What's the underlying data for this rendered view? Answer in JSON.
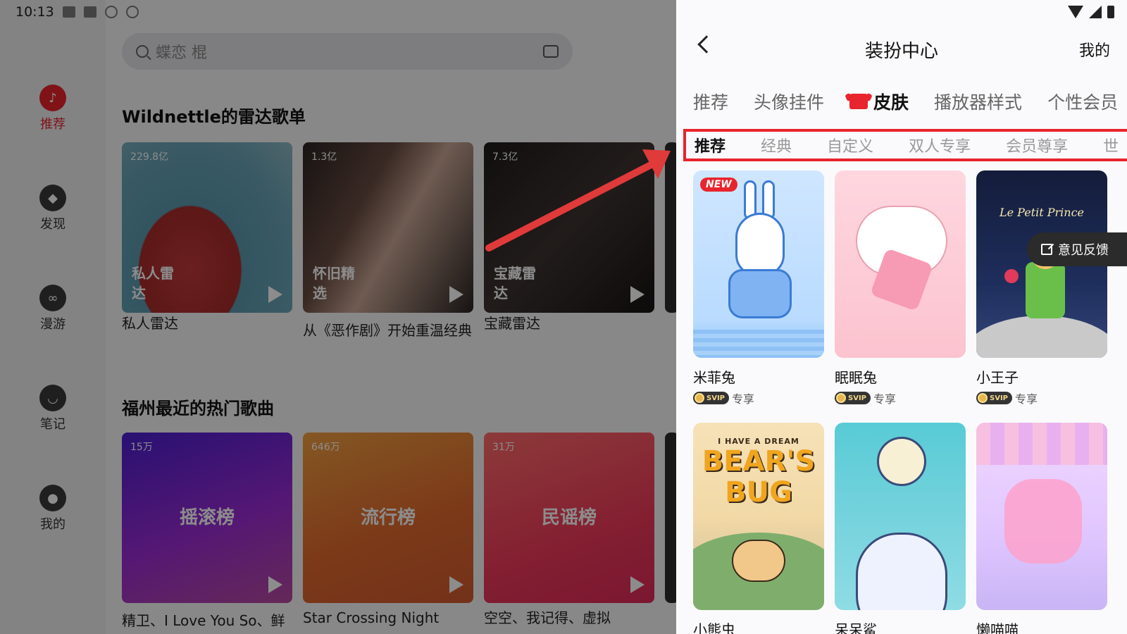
{
  "status_bar": {
    "time": "10:13"
  },
  "sidebar": {
    "items": [
      {
        "label": "推荐",
        "icon": "netease-logo-icon",
        "active": true
      },
      {
        "label": "发现",
        "icon": "compass-icon",
        "active": false
      },
      {
        "label": "漫游",
        "icon": "radio-icon",
        "active": false
      },
      {
        "label": "笔记",
        "icon": "chat-icon",
        "active": false
      },
      {
        "label": "我的",
        "icon": "user-vip-icon",
        "active": false
      }
    ]
  },
  "search": {
    "placeholder": "蝶恋 棍"
  },
  "sections": [
    {
      "title": "Wildnettle的雷达歌单",
      "cards": [
        {
          "plays": "229.8亿",
          "overlay": "私人雷达",
          "caption": "私人雷达"
        },
        {
          "plays": "1.3亿",
          "overlay": "怀旧精选",
          "caption": "从《恶作剧》开始重温经典"
        },
        {
          "plays": "7.3亿",
          "overlay": "宝藏雷达",
          "caption": "宝藏雷达"
        }
      ]
    },
    {
      "title": "福州最近的热门歌曲",
      "cards": [
        {
          "plays": "15万",
          "center": "摇滚榜",
          "caption": "精卫、I Love You So、鲜"
        },
        {
          "plays": "646万",
          "center": "流行榜",
          "caption": "Star Crossing Night (feat."
        },
        {
          "plays": "31万",
          "center": "民谣榜",
          "caption": "空空、我记得、虚拟"
        }
      ]
    }
  ],
  "panel": {
    "title": "装扮中心",
    "mine": "我的",
    "tabs": [
      "推荐",
      "头像挂件",
      "皮肤",
      "播放器样式",
      "个性会员"
    ],
    "active_tab": "皮肤",
    "subtabs": [
      "推荐",
      "经典",
      "自定义",
      "双人专享",
      "会员尊享",
      "世"
    ],
    "skins": [
      {
        "name": "米菲兔",
        "badge": "专享",
        "svip": "SVIP",
        "new": "NEW"
      },
      {
        "name": "眠眠兔",
        "badge": "专享",
        "svip": "SVIP"
      },
      {
        "name": "小王子",
        "badge": "专享",
        "svip": "SVIP",
        "art_text": "Le Petit Prince"
      },
      {
        "name": "小熊虫",
        "art_text_small": "I HAVE A DREAM",
        "art_text_big": "BEAR'S BUG"
      },
      {
        "name": "呆呆鲨"
      },
      {
        "name": "懒喵喵"
      }
    ],
    "feedback": "意见反馈"
  },
  "colors": {
    "accent": "#e8242d",
    "annotation": "#e03a3a"
  }
}
